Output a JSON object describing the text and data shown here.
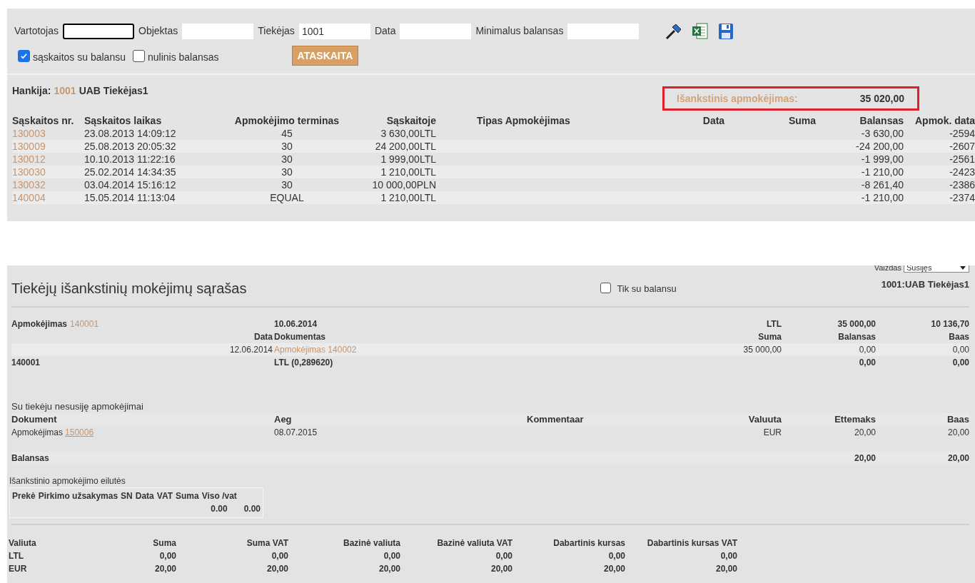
{
  "filters": {
    "fields": [
      {
        "label": "Vartotojas",
        "focused": true
      },
      {
        "label": "Objektas",
        "focused": false
      },
      {
        "label": "Tiekėjas",
        "value": "1001",
        "focused": false
      },
      {
        "label": "Data",
        "focused": false
      },
      {
        "label": "Minimalus balansas",
        "focused": false
      }
    ],
    "checkboxes": [
      {
        "label": "sąskaitos su balansu",
        "checked": true
      },
      {
        "label": "nulinis balansas",
        "checked": false
      }
    ],
    "report_button": "ATASKAITA"
  },
  "supplier": {
    "label": "Hankija:",
    "code": "1001",
    "name": "UAB Tiekėjas1"
  },
  "prepayment_total": {
    "label": "Išankstinis apmokėjimas:",
    "value": "35 020,00"
  },
  "invoices": {
    "columns": [
      "Sąskaitos nr.",
      "Sąskaitos laikas",
      "Apmokėjimo terminas",
      "Sąskaitoje",
      "Tipas Apmokėjimas",
      "Data",
      "Suma",
      "Balansas",
      "Apmok. data"
    ],
    "rows": [
      {
        "number": "130003",
        "time": "23.08.2013 14:09:12",
        "term": "45",
        "amount": "3 630,00LTL",
        "balance": "-3 630,00",
        "payment_date": "-2594"
      },
      {
        "number": "130009",
        "time": "25.08.2013 20:05:32",
        "term": "30",
        "amount": "24 200,00LTL",
        "balance": "-24 200,00",
        "payment_date": "-2607"
      },
      {
        "number": "130012",
        "time": "10.10.2013 11:22:16",
        "term": "30",
        "amount": "1 999,00LTL",
        "balance": "-1 999,00",
        "payment_date": "-2561"
      },
      {
        "number": "130030",
        "time": "25.02.2014 14:34:35",
        "term": "30",
        "amount": "1 210,00LTL",
        "balance": "-1 210,00",
        "payment_date": "-2423"
      },
      {
        "number": "130032",
        "time": "03.04.2014 15:16:12",
        "term": "30",
        "amount": "10 000,00PLN",
        "balance": "-8 261,40",
        "payment_date": "-2386"
      },
      {
        "number": "140004",
        "time": "15.05.2014 11:13:04",
        "term": "EQUAL",
        "amount": "1 210,00LTL",
        "balance": "-1 210,00",
        "payment_date": "-2374"
      }
    ]
  },
  "list": {
    "title": "Tiekėjų išankstinių mokėjimų sąrašas",
    "view": {
      "label": "Vaizdas",
      "value": "Susijęs"
    },
    "only_with_balance": {
      "label": "Tik su balansu",
      "checked": false
    },
    "supplier_ref": "1001:UAB Tiekėjas1",
    "payment_rows": [
      {
        "kind": "summary",
        "cells": [
          {
            "text": "Apmokėjimas",
            "link": "140001"
          },
          {
            "text": "10.06.2014"
          },
          null,
          {
            "text": "LTL"
          },
          {
            "text": "35 000,00"
          },
          {
            "text": "10 136,70"
          }
        ]
      },
      {
        "kind": "header",
        "cells": [
          {
            "text": "Data"
          },
          {
            "text": "Dokumentas"
          },
          null,
          {
            "text": "Suma"
          },
          {
            "text": "Balansas"
          },
          {
            "text": "Baas"
          }
        ]
      },
      {
        "kind": "line",
        "cells": [
          {
            "text": "12.06.2014"
          },
          {
            "link": "Apmokėjimas 140002"
          },
          null,
          {
            "text": "35 000,00"
          },
          {
            "text": "0,00"
          },
          {
            "text": "0,00"
          }
        ]
      },
      {
        "kind": "total",
        "cells": [
          {
            "text": "140001"
          },
          {
            "text": "LTL (0,289620)"
          },
          null,
          null,
          {
            "text": "0,00"
          },
          {
            "text": "0,00"
          }
        ]
      }
    ],
    "unrelated": {
      "title": "Su tiekėju nesusiję apmokėjimai",
      "columns": [
        "Dokument",
        "Aeg",
        "Kommentaar",
        "Valuuta",
        "Ettemaks",
        "Baas"
      ],
      "rows": [
        {
          "document": "Apmokėjimas",
          "link": "150006",
          "date": "08.07.2015",
          "currency": "EUR",
          "prepayment": "20,00",
          "base": "20,00"
        }
      ],
      "balance": {
        "label": "Balansas",
        "prepayment": "20,00",
        "base": "20,00"
      }
    },
    "lines": {
      "title": "Išankstinio apmokėjimo eilutės",
      "columns": [
        "Prekė",
        "Pirkimo užsakymas",
        "SN",
        "Data",
        "VAT",
        "Suma",
        "Viso /vat"
      ],
      "totals": [
        "0.00",
        "0.00"
      ]
    },
    "currencies": {
      "columns": [
        "Valiuta",
        "Suma",
        "Suma VAT",
        "Bazinė valiuta",
        "Bazinė valiuta VAT",
        "Dabartinis kursas",
        "Dabartinis kursas VAT"
      ],
      "rows": [
        [
          "LTL",
          "0,00",
          "0,00",
          "0,00",
          "0,00",
          "0,00",
          "0,00"
        ],
        [
          "EUR",
          "20,00",
          "20,00",
          "20,00",
          "20,00",
          "20,00",
          "20,00"
        ]
      ]
    }
  }
}
